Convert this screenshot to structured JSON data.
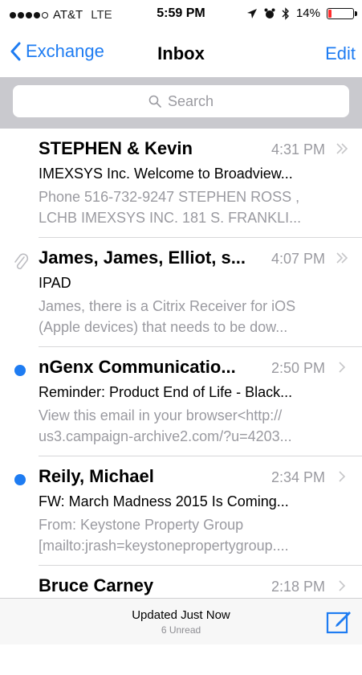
{
  "status_bar": {
    "carrier": "AT&T",
    "network": "LTE",
    "time": "5:59 PM",
    "battery": "14%",
    "battery_level": 0.14
  },
  "nav": {
    "back_label": "Exchange",
    "title": "Inbox",
    "edit_label": "Edit"
  },
  "search": {
    "placeholder": "Search"
  },
  "messages": [
    {
      "sender": "STEPHEN & Kevin",
      "time": "4:31 PM",
      "subject": "IMEXSYS Inc. Welcome to Broadview...",
      "preview_line1": "Phone 516-732-9247 STEPHEN ROSS ,",
      "preview_line2": "LCHB IMEXSYS INC. 181 S. FRANKLI..."
    },
    {
      "sender": "James, James, Elliot, s...",
      "time": "4:07 PM",
      "subject": "IPAD",
      "preview_line1": "James, there is a Citrix Receiver for iOS",
      "preview_line2": "(Apple devices) that needs to be dow..."
    },
    {
      "sender": "nGenx Communicatio...",
      "time": "2:50 PM",
      "subject": "Reminder: Product End of Life - Black...",
      "preview_line1": "View this email in your browser<http://",
      "preview_line2": "us3.campaign-archive2.com/?u=4203..."
    },
    {
      "sender": "Reily, Michael",
      "time": "2:34 PM",
      "subject": "FW: March Madness 2015 Is Coming...",
      "preview_line1": "From: Keystone Property Group",
      "preview_line2": "[mailto:jrash=keystonepropertygroup...."
    },
    {
      "sender": "Bruce Carney",
      "time": "2:18 PM"
    }
  ],
  "toolbar": {
    "status": "Updated Just Now",
    "unread": "6 Unread"
  },
  "colors": {
    "accent": "#1e7cf2",
    "search_bg": "#c9c9ce",
    "secondary_text": "#9a9aa0"
  }
}
